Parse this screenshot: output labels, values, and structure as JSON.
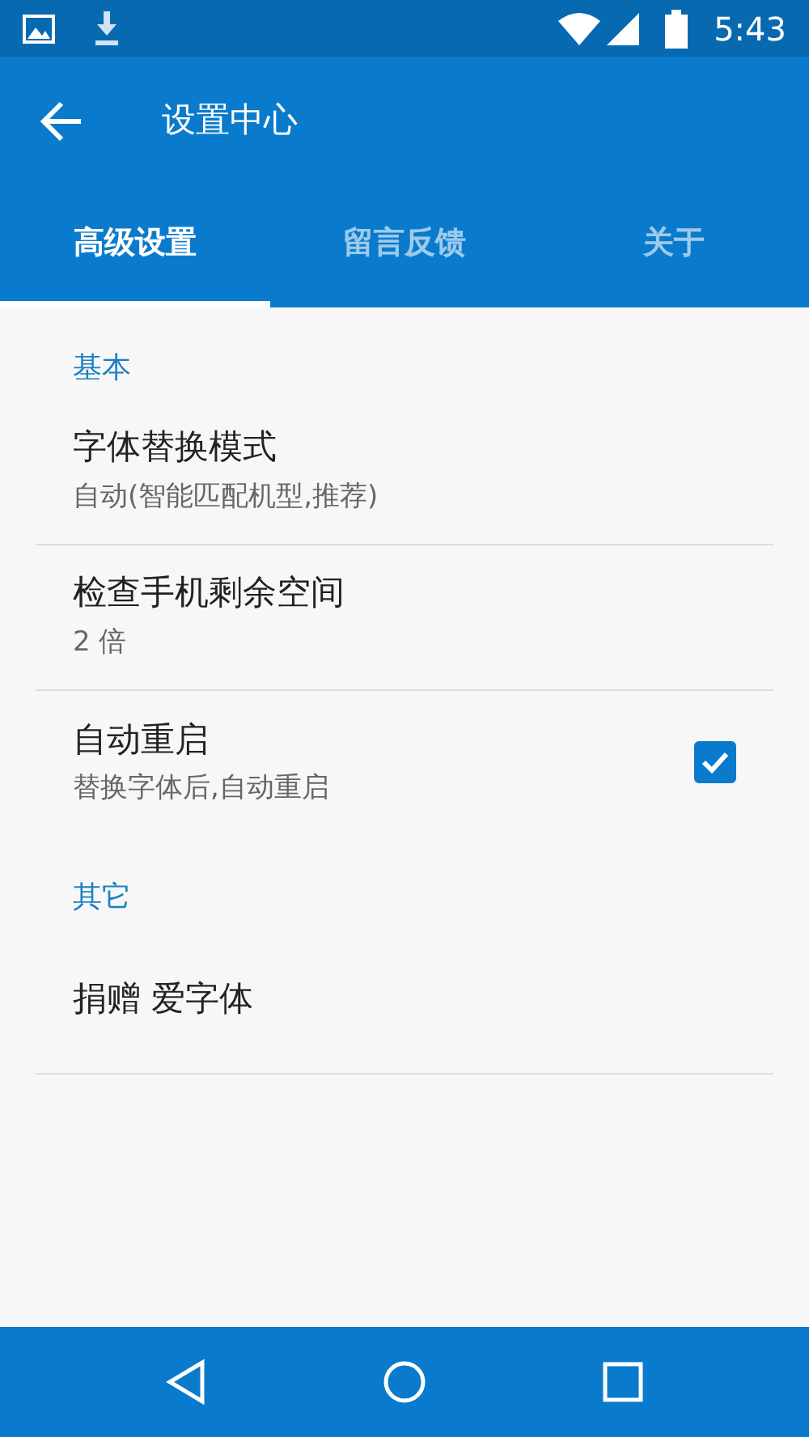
{
  "status_bar": {
    "time": "5:43"
  },
  "toolbar": {
    "title": "设置中心"
  },
  "tabs": [
    {
      "label": "高级设置",
      "selected": true
    },
    {
      "label": "留言反馈",
      "selected": false
    },
    {
      "label": "关于",
      "selected": false
    }
  ],
  "sections": [
    {
      "header": "基本",
      "items": [
        {
          "kind": "text",
          "title": "字体替换模式",
          "summary": "自动(智能匹配机型,推荐)"
        },
        {
          "kind": "text",
          "title": "检查手机剩余空间",
          "summary": "2 倍"
        },
        {
          "kind": "checkbox",
          "title": "自动重启",
          "summary": "替换字体后,自动重启",
          "checked": true
        }
      ]
    },
    {
      "header": "其它",
      "items": [
        {
          "kind": "text",
          "title": "捐赠 爱字体"
        }
      ]
    }
  ]
}
